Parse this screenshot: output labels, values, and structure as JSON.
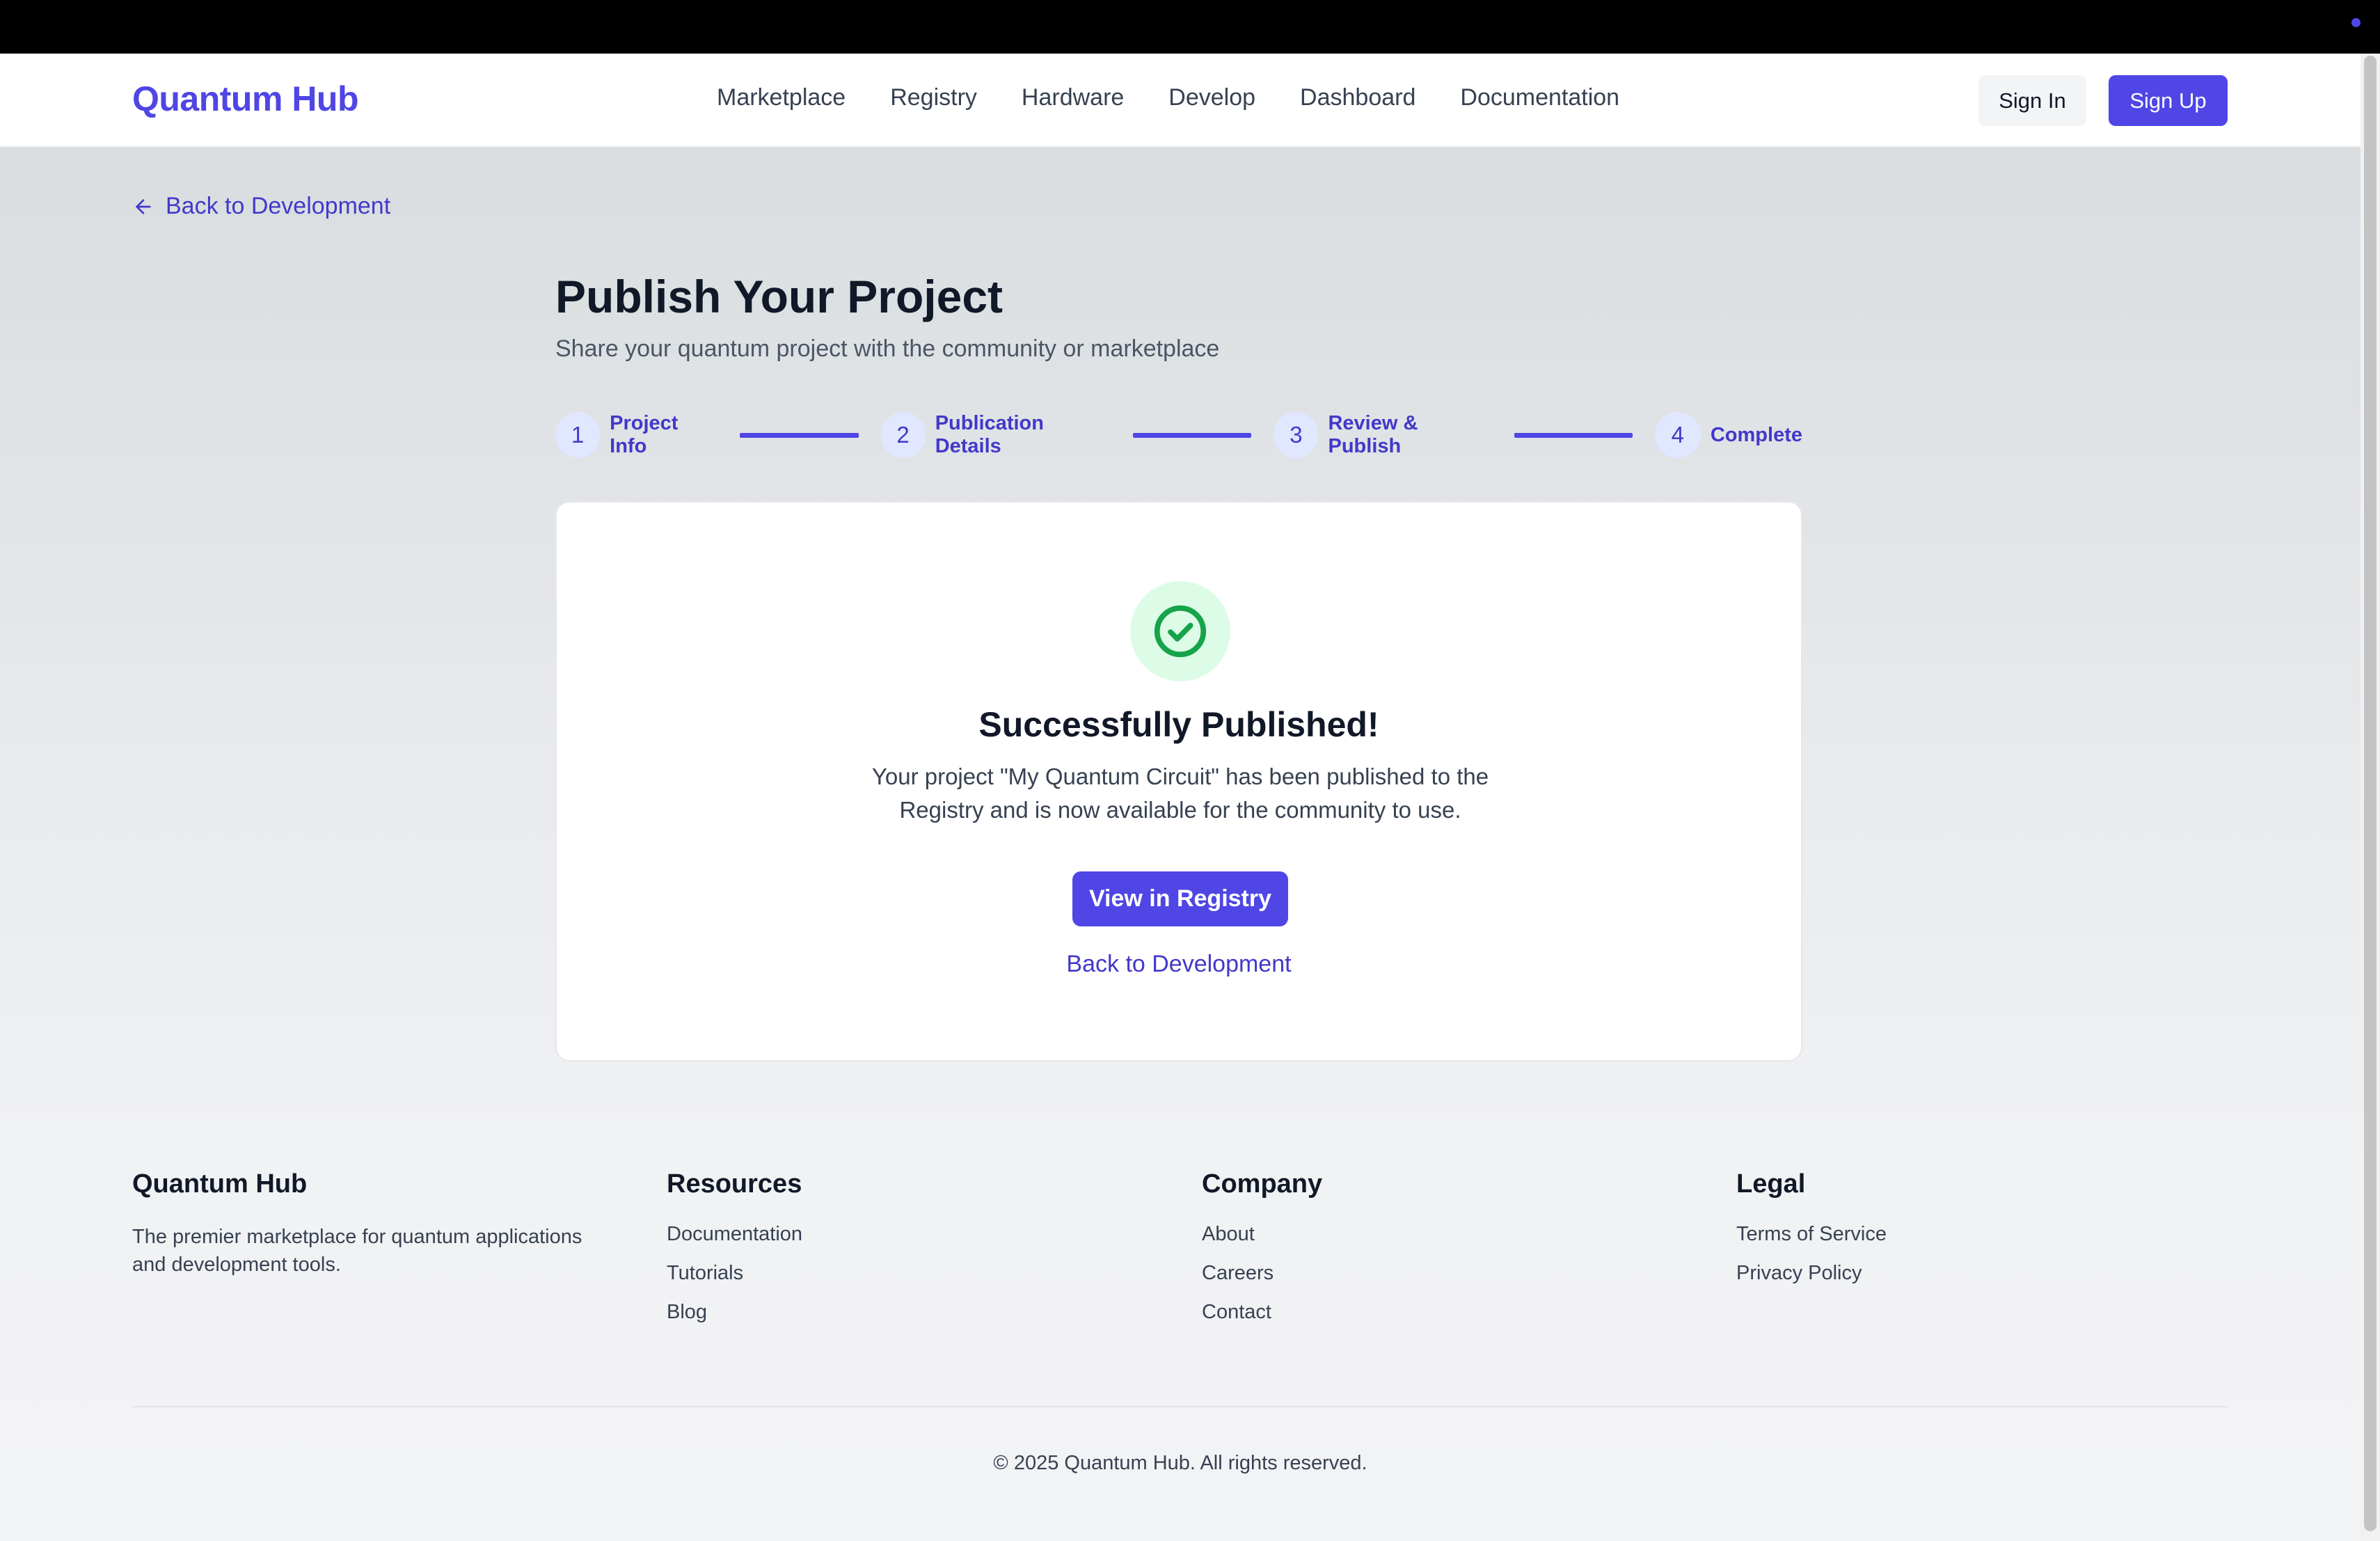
{
  "header": {
    "logo": "Quantum Hub",
    "nav": [
      "Marketplace",
      "Registry",
      "Hardware",
      "Develop",
      "Dashboard",
      "Documentation"
    ],
    "sign_in": "Sign In",
    "sign_up": "Sign Up"
  },
  "back_link_top": "Back to Development",
  "page": {
    "title": "Publish Your Project",
    "subtitle": "Share your quantum project with the community or marketplace"
  },
  "steps": [
    {
      "number": "1",
      "label": "Project Info"
    },
    {
      "number": "2",
      "label": "Publication Details"
    },
    {
      "number": "3",
      "label": "Review & Publish"
    },
    {
      "number": "4",
      "label": "Complete"
    }
  ],
  "card": {
    "icon": "check-circle-icon",
    "title": "Successfully Published!",
    "message": "Your project \"My Quantum Circuit\" has been published to the Registry and is now available for the community to use.",
    "primary_button": "View in Registry",
    "secondary_link": "Back to Development"
  },
  "footer": {
    "brand": {
      "title": "Quantum Hub",
      "description": "The premier marketplace for quantum applications and development tools."
    },
    "resources": {
      "title": "Resources",
      "links": [
        "Documentation",
        "Tutorials",
        "Blog"
      ]
    },
    "company": {
      "title": "Company",
      "links": [
        "About",
        "Careers",
        "Contact"
      ]
    },
    "legal": {
      "title": "Legal",
      "links": [
        "Terms of Service",
        "Privacy Policy"
      ]
    },
    "copyright": "© 2025 Quantum Hub. All rights reserved."
  },
  "colors": {
    "accent": "#4f46e5",
    "accent_text": "#4338ca",
    "success_bg": "#dcfce7",
    "success_icon": "#16a34a"
  }
}
